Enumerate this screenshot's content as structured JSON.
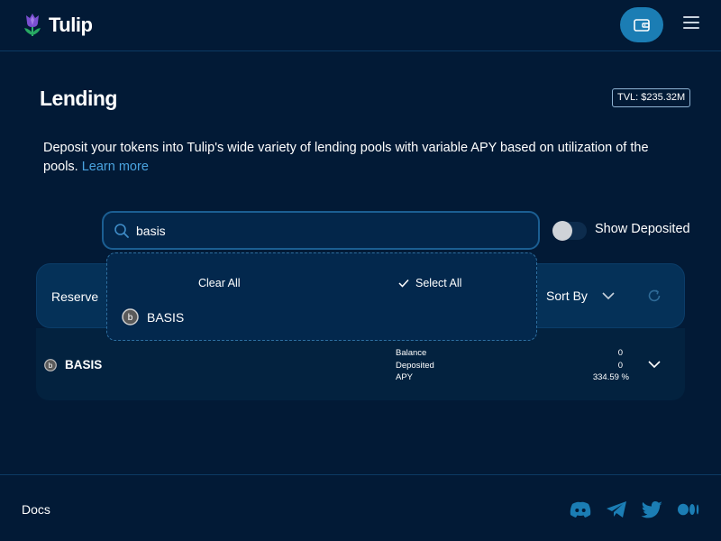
{
  "brand": {
    "name": "Tulip"
  },
  "page": {
    "title": "Lending",
    "tvl": "TVL: $235.32M",
    "description": "Deposit your tokens into Tulip's wide variety of lending pools with variable APY based on utilization of the pools.",
    "learn_more": "Learn more"
  },
  "search": {
    "value": "basis",
    "placeholder": ""
  },
  "toggle": {
    "label": "Show Deposited",
    "on": false
  },
  "dropdown": {
    "clear_all": "Clear All",
    "select_all": "Select All",
    "options": [
      {
        "label": "BASIS"
      }
    ]
  },
  "table": {
    "reserve_header": "Reserve",
    "sort_by": "Sort By",
    "rows": [
      {
        "token": "BASIS",
        "stats": [
          {
            "label": "Balance",
            "value": "0"
          },
          {
            "label": "Deposited",
            "value": "0"
          },
          {
            "label": "APY",
            "value": "334.59 %"
          }
        ]
      }
    ]
  },
  "footer": {
    "docs": "Docs",
    "social": [
      "discord-icon",
      "telegram-icon",
      "twitter-icon",
      "medium-icon"
    ]
  },
  "colors": {
    "background": "#021a36",
    "accent": "#1b7db4",
    "link": "#4aa3df",
    "social": "#1b7db4"
  }
}
